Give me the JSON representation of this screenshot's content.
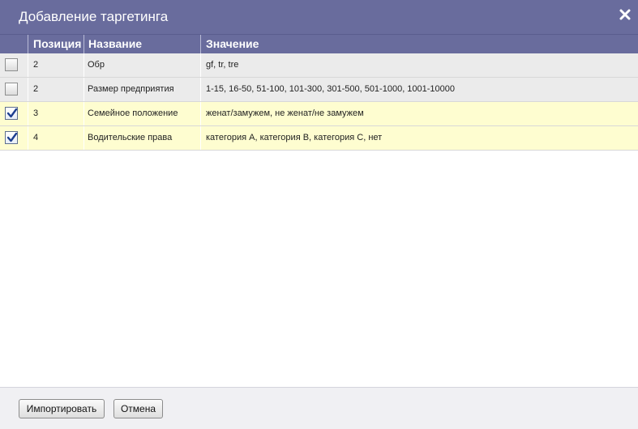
{
  "dialog": {
    "title": "Добавление таргетинга",
    "close_icon": "close-icon"
  },
  "table": {
    "columns": [
      "Позиция",
      "Название",
      "Значение"
    ],
    "rows": [
      {
        "checked": false,
        "position": "2",
        "name": "Обр",
        "value": "gf, tr, tre"
      },
      {
        "checked": false,
        "position": "2",
        "name": "Размер предприятия",
        "value": "1-15, 16-50, 51-100, 101-300, 301-500, 501-1000, 1001-10000"
      },
      {
        "checked": true,
        "position": "3",
        "name": "Семейное положение",
        "value": "женат/замужем, не женат/не замужем"
      },
      {
        "checked": true,
        "position": "4",
        "name": "Водительские права",
        "value": "категория A, категория B, категория C, нет"
      }
    ]
  },
  "footer": {
    "import_label": "Импортировать",
    "cancel_label": "Отмена"
  },
  "colors": {
    "header": "#696c9d",
    "checked_row": "#fefdd0",
    "unchecked_row": "#ebebeb"
  }
}
